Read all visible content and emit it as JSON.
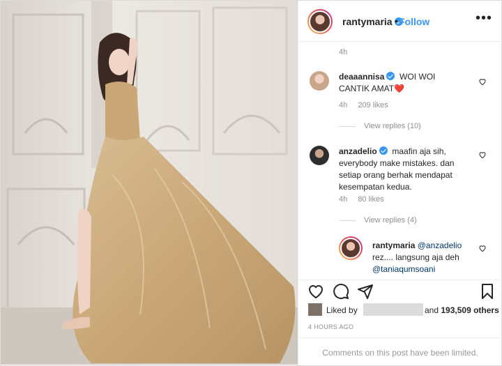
{
  "post": {
    "username": "rantymaria",
    "separator": "•",
    "follow_label": "Follow",
    "more_label": "•••",
    "caption_time": "4h"
  },
  "comments": [
    {
      "username": "deaaannisa",
      "text": "WOI WOI CANTIK AMAT",
      "emoji": "❤️",
      "time": "4h",
      "likes": "209 likes",
      "view_replies": "View replies (10)"
    },
    {
      "username": "anzadelio",
      "text": "maafin aja sih, everybody make mistakes. dan setiap orang berhak mendapat kesempatan kedua.",
      "time": "4h",
      "likes": "80 likes",
      "view_replies": "View replies (4)"
    }
  ],
  "reply": {
    "username": "rantymaria",
    "mention1": "@anzadelio",
    "text": "rez.... langsung aja deh",
    "mention2": "@taniaqumsoani"
  },
  "footer": {
    "liked_by": "Liked by",
    "and_label": "and",
    "like_count": "193,509 others",
    "posted_ago": "4 HOURS AGO",
    "comments_limited": "Comments on this post have been limited."
  },
  "icons": {
    "heart": "heart-icon",
    "comment": "comment-icon",
    "share": "share-icon",
    "save": "bookmark-icon"
  },
  "colors": {
    "link_blue": "#3897f0",
    "muted": "#8e8e8e"
  }
}
